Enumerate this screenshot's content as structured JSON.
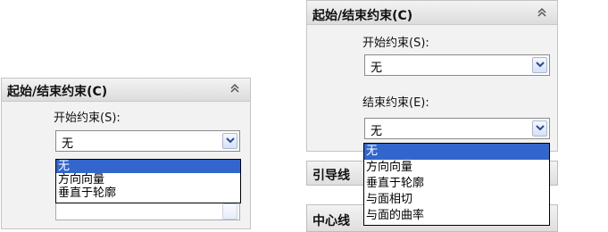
{
  "panel_left": {
    "title": "起始/结束约束(C)",
    "start_label": "开始约束(S):",
    "start_value": "无",
    "dropdown_items": [
      "无",
      "方向向量",
      "垂直于轮廓"
    ],
    "selected_index": 0
  },
  "panel_right": {
    "title": "起始/结束约束(C)",
    "start_label": "开始约束(S):",
    "start_value": "无",
    "end_label": "结束约束(E):",
    "end_value": "无",
    "dropdown_items": [
      "无",
      "方向向量",
      "垂直于轮廓",
      "与面相切",
      "与面的曲率"
    ],
    "selected_index": 0,
    "guide_section_title": "引导线",
    "center_section_title": "中心线"
  },
  "icons": {
    "collapse": "double-chevron-up-icon",
    "dropdown": "chevron-down-icon"
  },
  "colors": {
    "selection": "#3366cc",
    "panel_bg": "#f2f2f2"
  }
}
